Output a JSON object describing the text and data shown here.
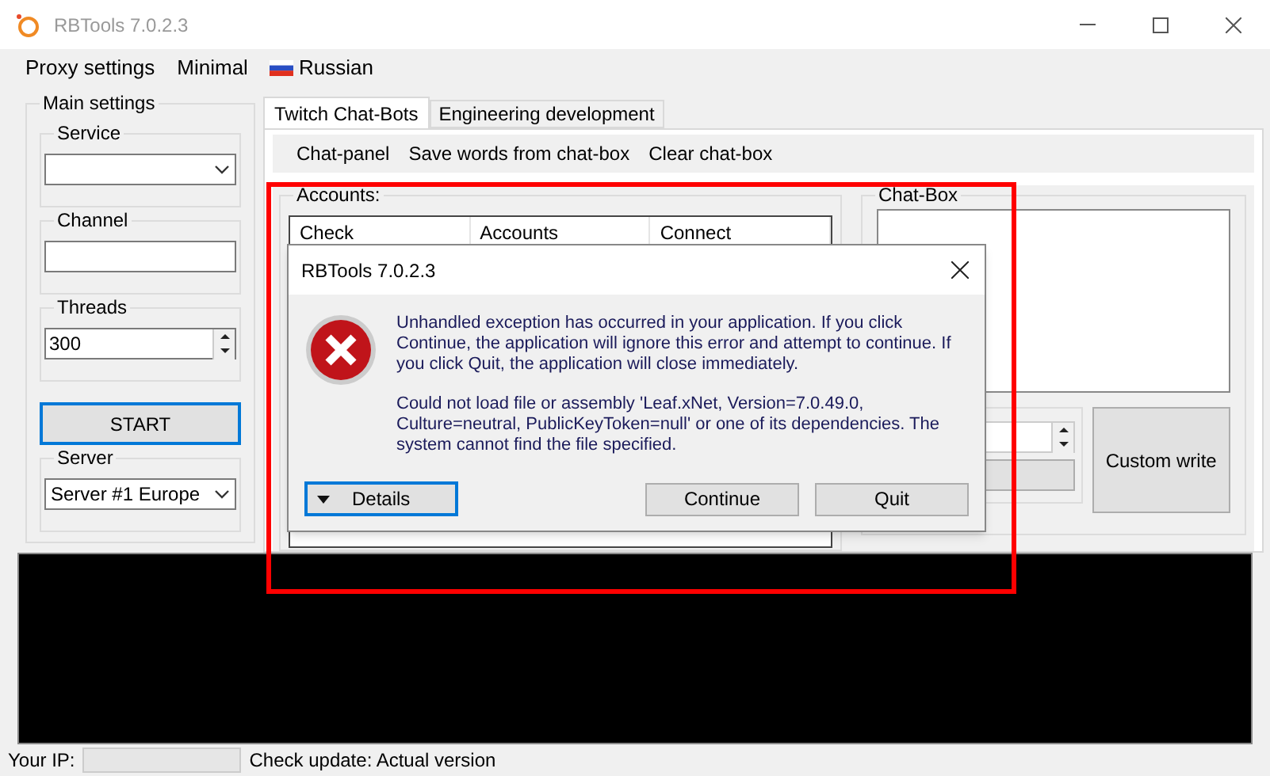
{
  "window": {
    "title": "RBTools 7.0.2.3"
  },
  "menu": [
    {
      "label": "Proxy settings",
      "kind": "text"
    },
    {
      "label": "Minimal",
      "kind": "text"
    },
    {
      "label": "Russian",
      "kind": "flag"
    }
  ],
  "main_settings": {
    "title": "Main settings",
    "service": {
      "label": "Service"
    },
    "channel": {
      "label": "Channel"
    },
    "threads": {
      "label": "Threads",
      "value": "300"
    },
    "start_button": "START",
    "server": {
      "label": "Server",
      "value": "Server #1 Europe"
    }
  },
  "tabs": [
    {
      "label": "Twitch Chat-Bots",
      "selected": true
    },
    {
      "label": "Engineering development",
      "selected": false
    }
  ],
  "toolbar": [
    "Chat-panel",
    "Save words from chat-box",
    "Clear chat-box"
  ],
  "accounts": {
    "title": "Accounts:",
    "columns": [
      "Check",
      "Accounts",
      "Connect"
    ]
  },
  "chat_box": {
    "title": "Chat-Box",
    "custom_write": "Custom write"
  },
  "status_bar": {
    "ip_label": "Your IP:",
    "update": "Check update: Actual version"
  },
  "dialog": {
    "title": "RBTools 7.0.2.3",
    "message": "Unhandled exception has occurred in your application. If you click Continue, the application will ignore this error and attempt to continue. If you click Quit, the application will close immediately.",
    "detail": "Could not load file or assembly 'Leaf.xNet, Version=7.0.49.0, Culture=neutral, PublicKeyToken=null' or one of its dependencies. The system cannot find the file specified.",
    "details_button": "Details",
    "buttons": [
      "Continue",
      "Quit"
    ]
  }
}
